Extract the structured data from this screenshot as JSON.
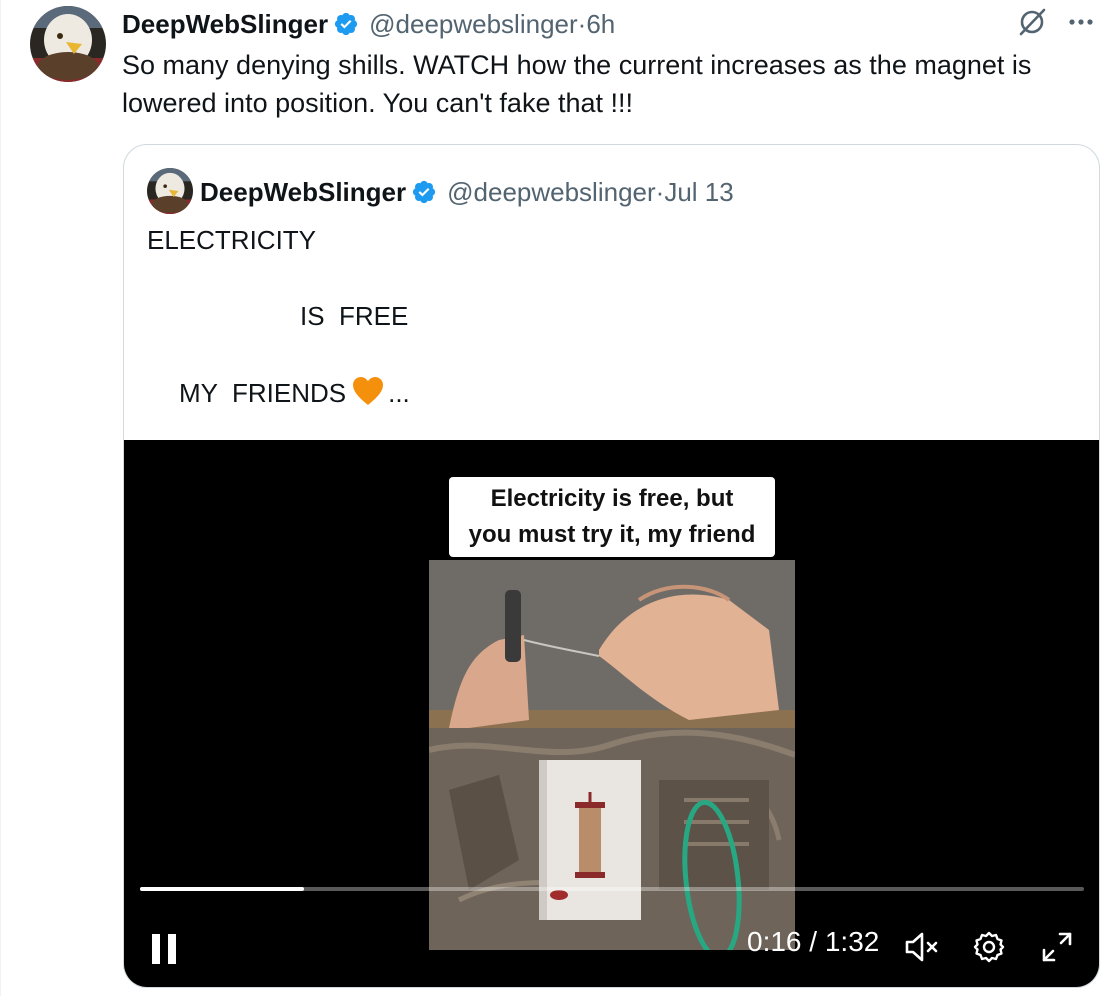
{
  "colors": {
    "text": "#0f1419",
    "secondary": "#536471",
    "verified": "#1d9bf0",
    "border": "#cfd9de",
    "heart": "#f4900c"
  },
  "tweet": {
    "author_name": "DeepWebSlinger",
    "handle": "@deepwebslinger",
    "time": "6h",
    "separator": " · ",
    "text": "So many denying shills. WATCH how the current increases as the magnet is lowered into position. You can't fake that !!!"
  },
  "quoted": {
    "author_name": "DeepWebSlinger",
    "handle": "@deepwebslinger",
    "date": "Jul 13",
    "separator": " · ",
    "line1": "ELECTRICITY",
    "line2": "IS  FREE",
    "line3": "MY  FRIENDS",
    "line3_suffix": "...",
    "video": {
      "caption_line1": "Electricity is free, but",
      "caption_line2": "you must try it, my friend",
      "current_time": "0:16",
      "duration": "1:32",
      "time_separator": " / ",
      "progress_fraction": 0.174,
      "icons": [
        "pause-icon",
        "mute-icon",
        "settings-icon",
        "fullscreen-icon"
      ]
    }
  },
  "icons": [
    "grok-icon",
    "more-icon",
    "verified-badge-icon",
    "orange-heart-icon"
  ]
}
